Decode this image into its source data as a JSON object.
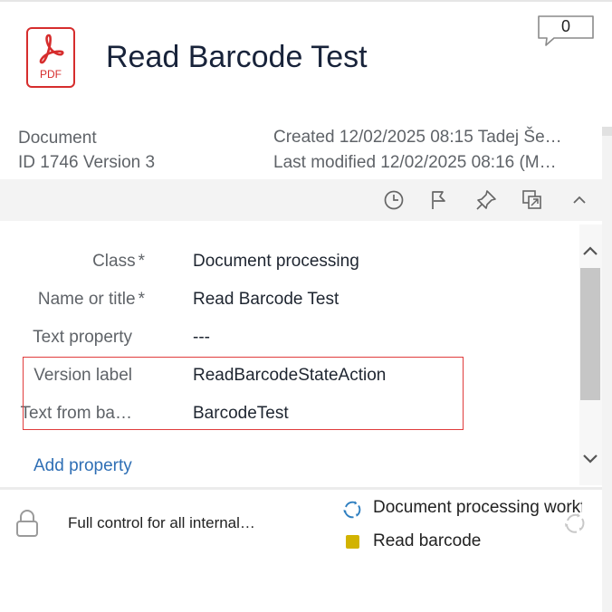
{
  "header": {
    "file_icon_label": "PDF",
    "title": "Read Barcode Test",
    "comment_count": "0"
  },
  "meta": {
    "type": "Document",
    "id_version": "ID 1746  Version 3",
    "created": "Created 12/02/2025 08:15 Tadej Še…",
    "modified": "Last modified 12/02/2025 08:16 (M…"
  },
  "toolbar": {
    "icons": [
      "history-icon",
      "flag-icon",
      "pin-icon",
      "pop-out-icon",
      "collapse-icon"
    ]
  },
  "properties": [
    {
      "label": "Class",
      "required": "*",
      "value": "Document processing"
    },
    {
      "label": "Name or title",
      "required": "*",
      "value": "Read Barcode Test"
    },
    {
      "label": "Text property",
      "required": "",
      "value": "---"
    },
    {
      "label": "Version label",
      "required": "",
      "value": "ReadBarcodeStateAction"
    },
    {
      "label": "Text from ba…",
      "required": "",
      "value": "BarcodeTest"
    }
  ],
  "add_property_label": "Add property",
  "footer": {
    "permissions": "Full control for all internal…",
    "workflow": "Document processing workflow",
    "state": "Read barcode",
    "state_color": "#d2b300"
  },
  "colors": {
    "accent_link": "#2f6fb5",
    "pdf_red": "#d62d2d",
    "highlight_border": "#e03c3c"
  }
}
